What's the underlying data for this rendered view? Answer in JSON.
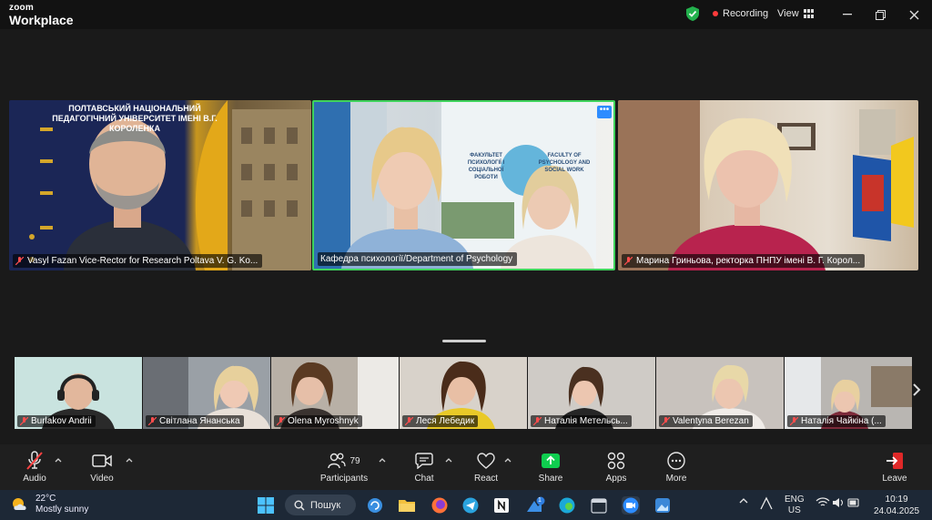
{
  "app": {
    "brand_top": "zoom",
    "brand_bottom": "Workplace"
  },
  "titlebar": {
    "recording": "Recording",
    "view": "View"
  },
  "speakers": [
    {
      "name": "Vasyl Fazan Vice-Rector for Research Poltava V. G. Ko...",
      "banner": "ПОЛТАВСЬКИЙ НАЦІОНАЛЬНИЙ ПЕДАГОГІЧНИЙ УНІВЕРСИТЕТ ІМЕНІ В.Г. КОРОЛЕНКА"
    },
    {
      "name": "Кафедра психології/Department of Psychology",
      "poster_left": "ФАКУЛЬТЕТ ПСИХОЛОГІЇ І СОЦІАЛЬНОЇ РОБОТИ",
      "poster_right": "FACULTY OF PSYCHOLOGY AND SOCIAL WORK"
    },
    {
      "name": "Марина Гриньова, ректорка ПНПУ імені В. Г. Корол..."
    }
  ],
  "gallery": [
    {
      "name": "Burlakov Andrii"
    },
    {
      "name": "Світлана  Янанська"
    },
    {
      "name": "Olena Myroshnyk"
    },
    {
      "name": "Леся Лебедик"
    },
    {
      "name": "Наталія Метельсь..."
    },
    {
      "name": "Valentyna Berezan"
    },
    {
      "name": "Наталія Чайкіна (..."
    }
  ],
  "toolbar": {
    "audio": "Audio",
    "video": "Video",
    "participants": "Participants",
    "participants_count": "79",
    "chat": "Chat",
    "react": "React",
    "share": "Share",
    "apps": "Apps",
    "more": "More",
    "leave": "Leave"
  },
  "taskbar": {
    "temp": "22°C",
    "weather": "Mostly sunny",
    "search": "Пошук",
    "lang1": "ENG",
    "lang2": "US",
    "time": "10:19",
    "date": "24.04.2025",
    "badge": "1"
  },
  "colors": {
    "share_green": "#0fce4f",
    "leave_red": "#e02828",
    "active_border": "#3fd35c",
    "accent_blue": "#2d8cff"
  }
}
